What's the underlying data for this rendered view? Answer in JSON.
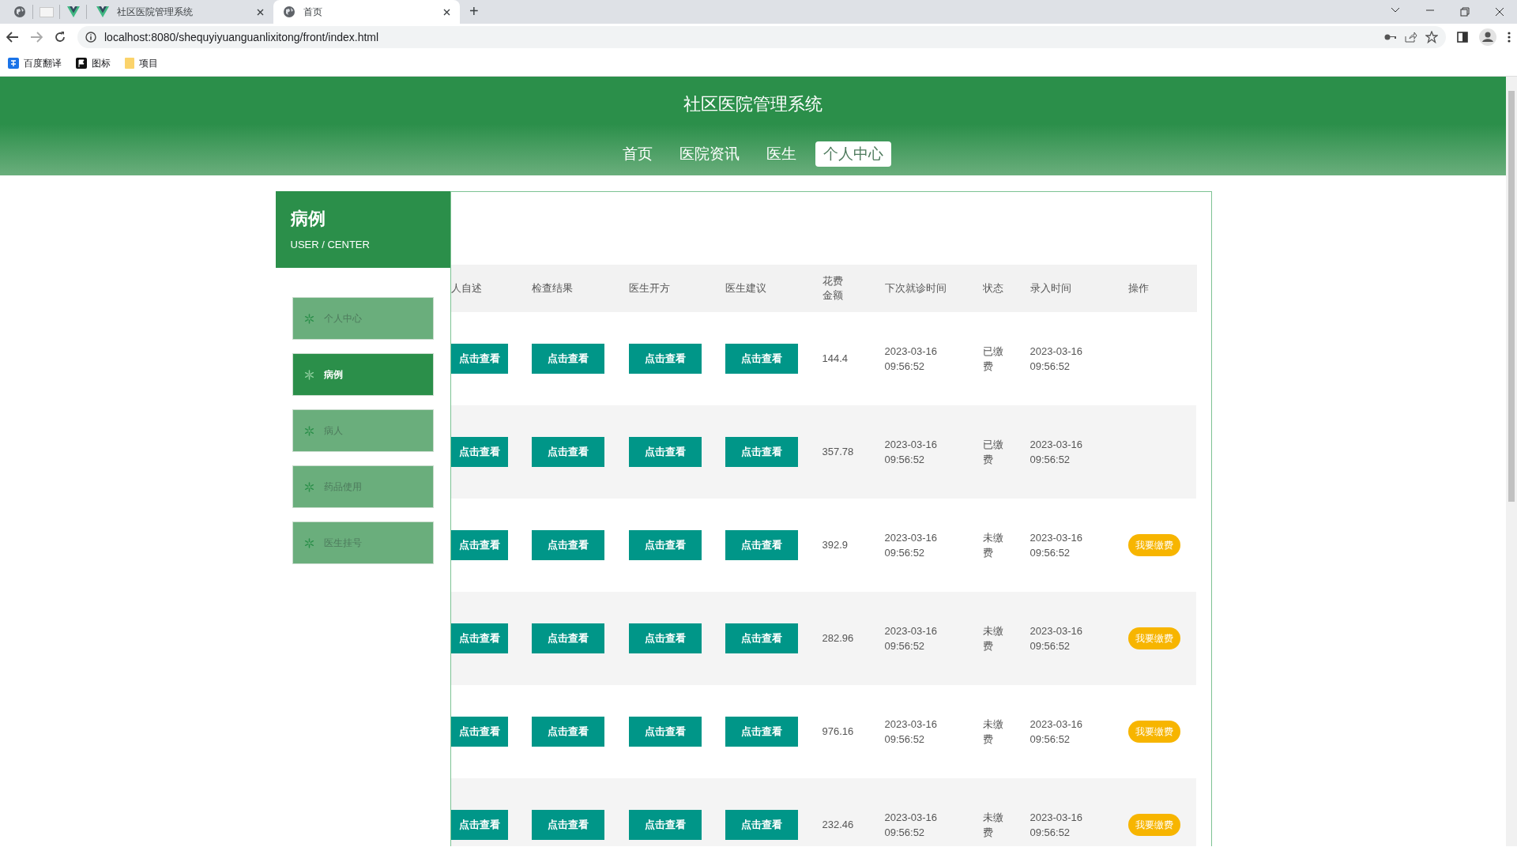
{
  "browser": {
    "tabs": [
      {
        "title": "社区医院管理系统",
        "selected": false
      },
      {
        "title": "首页",
        "selected": true
      }
    ],
    "new_tab": "+",
    "url": "localhost:8080/shequyiyuanguanlixitong/front/index.html",
    "bookmarks": [
      {
        "label": "百度翻译",
        "kind": "translate"
      },
      {
        "label": "图标",
        "kind": "flag"
      },
      {
        "label": "项目",
        "kind": "folder"
      }
    ]
  },
  "site": {
    "title": "社区医院管理系统",
    "nav": [
      {
        "label": "首页",
        "selected": false
      },
      {
        "label": "医院资讯",
        "selected": false
      },
      {
        "label": "医生",
        "selected": false
      },
      {
        "label": "个人中心",
        "selected": true
      }
    ],
    "sidebar": {
      "title": "病例",
      "subtitle": "USER / CENTER",
      "items": [
        {
          "label": "个人中心",
          "selected": false
        },
        {
          "label": "病例",
          "selected": true
        },
        {
          "label": "病人",
          "selected": false
        },
        {
          "label": "药品使用",
          "selected": false
        },
        {
          "label": "医生挂号",
          "selected": false
        }
      ]
    },
    "table": {
      "columns": [
        "人自述",
        "检查结果",
        "医生开方",
        "医生建议",
        "花费金额",
        "下次就诊时间",
        "状态",
        "录入时间",
        "操作"
      ],
      "rows": [
        {
          "views": [
            "点击查看",
            "点击查看",
            "点击查看",
            "点击查看"
          ],
          "amount": "144.4",
          "next_visit": "2023-03-16 09:56:52",
          "status": "已缴费",
          "entered": "2023-03-16 09:56:52"
        },
        {
          "views": [
            "点击查看",
            "点击查看",
            "点击查看",
            "点击查看"
          ],
          "amount": "357.78",
          "next_visit": "2023-03-16 09:56:52",
          "status": "已缴费",
          "entered": "2023-03-16 09:56:52"
        },
        {
          "views": [
            "点击查看",
            "点击查看",
            "点击查看",
            "点击查看"
          ],
          "amount": "392.9",
          "next_visit": "2023-03-16 09:56:52",
          "status": "未缴费",
          "entered": "2023-03-16 09:56:52",
          "action": "我要缴费"
        },
        {
          "views": [
            "点击查看",
            "点击查看",
            "点击查看",
            "点击查看"
          ],
          "amount": "282.96",
          "next_visit": "2023-03-16 09:56:52",
          "status": "未缴费",
          "entered": "2023-03-16 09:56:52",
          "action": "我要缴费"
        },
        {
          "views": [
            "点击查看",
            "点击查看",
            "点击查看",
            "点击查看"
          ],
          "amount": "976.16",
          "next_visit": "2023-03-16 09:56:52",
          "status": "未缴费",
          "entered": "2023-03-16 09:56:52",
          "action": "我要缴费"
        },
        {
          "views": [
            "点击查看",
            "点击查看",
            "点击查看",
            "点击查看"
          ],
          "amount": "232.46",
          "next_visit": "2023-03-16 09:56:52",
          "status": "未缴费",
          "entered": "2023-03-16 09:56:52",
          "action": "我要缴费"
        }
      ]
    }
  }
}
